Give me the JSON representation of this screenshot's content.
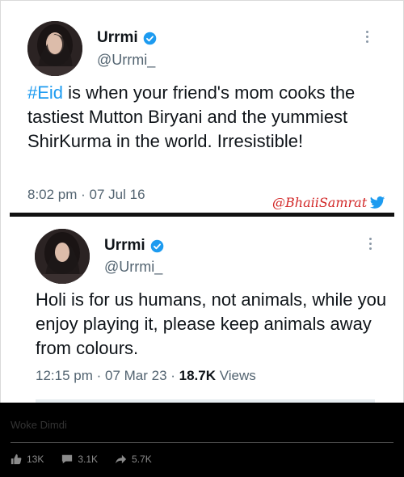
{
  "tweets": [
    {
      "author": "Urrmi",
      "handle": "@Urrmi_",
      "hashtag": "#Eid",
      "text": " is when your friend's mom cooks the tastiest Mutton Biryani and the yummiest ShirKurma in the world. Irresistible!",
      "timestamp": "8:02 pm · 07 Jul 16",
      "watermark": "@BhaiiSamrat"
    },
    {
      "author": "Urrmi",
      "handle": "@Urrmi_",
      "text": "Holi is for us humans, not animals, while you enjoy playing it, please keep animals away from colours.",
      "timestamp": "12:15 pm · 07 Mar 23 · ",
      "views_count": "18.7K",
      "views_label": " Views"
    }
  ],
  "post": {
    "title": "Woke Dimdi",
    "stats": {
      "likes": "13K",
      "comments": "3.1K",
      "shares": "5.7K"
    }
  },
  "colors": {
    "accent": "#1d9bf0",
    "text": "#0f1419",
    "muted": "#536471",
    "watermark": "#d22727"
  }
}
